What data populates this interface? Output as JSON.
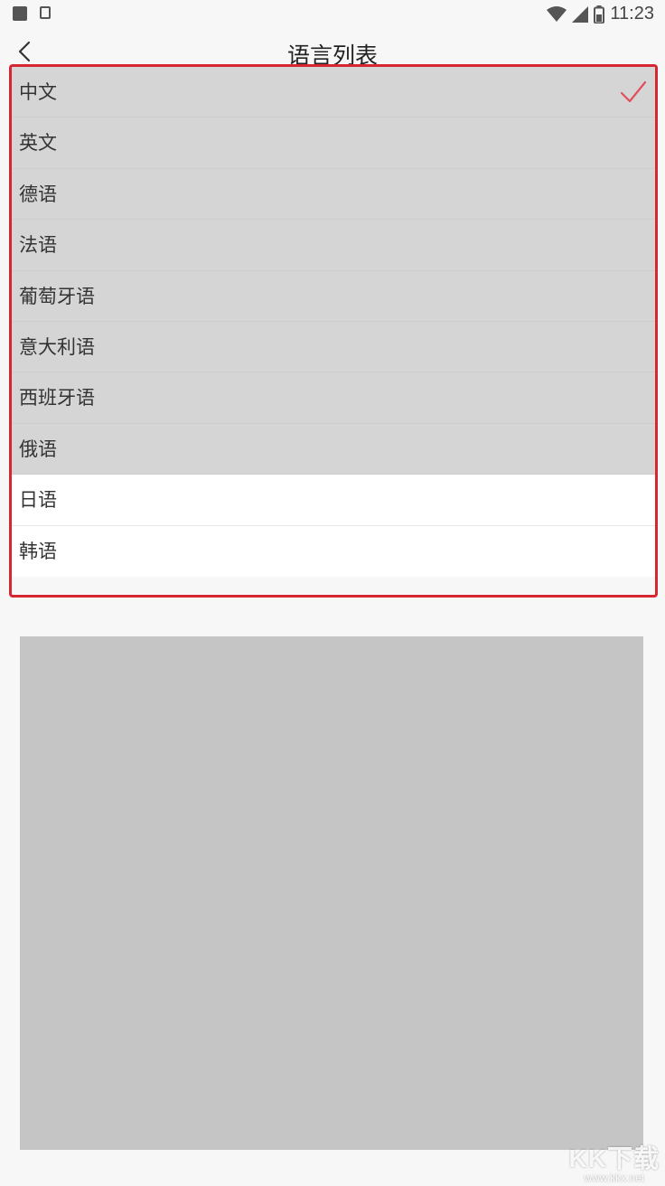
{
  "status_bar": {
    "time": "11:23",
    "icons": [
      "notification-square-icon",
      "sim-icon",
      "wifi-icon",
      "signal-icon",
      "battery-icon"
    ]
  },
  "header": {
    "title": "语言列表",
    "back_icon": "chevron-left-icon"
  },
  "languages": [
    {
      "label": "中文",
      "selected": true
    },
    {
      "label": "英文",
      "selected": false
    },
    {
      "label": "德语",
      "selected": false
    },
    {
      "label": "法语",
      "selected": false
    },
    {
      "label": "葡萄牙语",
      "selected": false
    },
    {
      "label": "意大利语",
      "selected": false
    },
    {
      "label": "西班牙语",
      "selected": false
    },
    {
      "label": "俄语",
      "selected": false
    },
    {
      "label": "日语",
      "selected": false
    },
    {
      "label": "韩语",
      "selected": false
    }
  ],
  "colors": {
    "highlight_border": "#d52631",
    "check": "#e0505a",
    "dim_row": "#d5d5d5",
    "placeholder": "#c5c5c5"
  },
  "watermark": {
    "logo": "KK下载",
    "url": "www.kkx.net"
  }
}
